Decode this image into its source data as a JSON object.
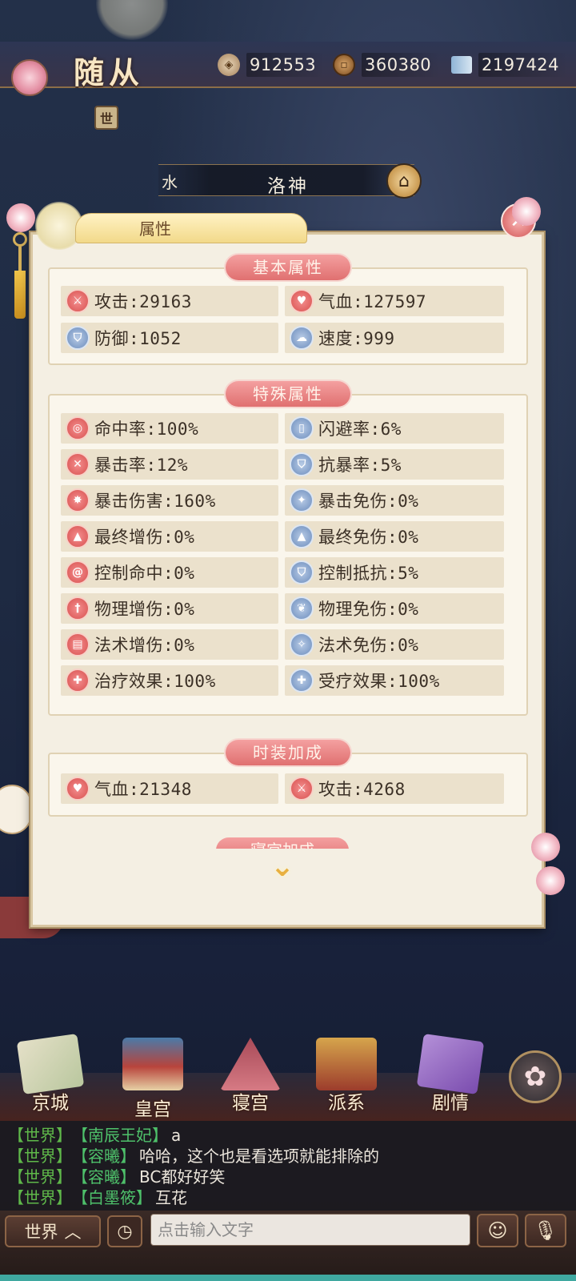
{
  "header": {
    "title": "随从",
    "currencies": [
      {
        "icon": "jade-token-icon",
        "value": "912553"
      },
      {
        "icon": "copper-coin-icon",
        "value": "360380"
      },
      {
        "icon": "book-icon",
        "value": "2197424"
      }
    ],
    "world_mini_label": "世"
  },
  "character": {
    "element": "水",
    "name": "洛神"
  },
  "panel": {
    "tab_label": "属性",
    "close_glyph": "✕",
    "sections": {
      "basic": {
        "title": "基本属性",
        "stats": [
          {
            "icon": "sword-icon",
            "text": "攻击:29163"
          },
          {
            "icon": "heart-icon",
            "text": "气血:127597"
          },
          {
            "icon": "shield-icon",
            "text": "防御:1052"
          },
          {
            "icon": "cloud-speed-icon",
            "text": "速度:999"
          }
        ]
      },
      "special": {
        "title": "特殊属性",
        "stats": [
          {
            "icon": "target-icon",
            "text": "命中率:100%"
          },
          {
            "icon": "scroll-icon",
            "text": "闪避率:6%"
          },
          {
            "icon": "crossed-swords-icon",
            "text": "暴击率:12%"
          },
          {
            "icon": "crit-resist-icon",
            "text": "抗暴率:5%"
          },
          {
            "icon": "burst-icon",
            "text": "暴击伤害:160%"
          },
          {
            "icon": "crit-reduction-icon",
            "text": "暴击免伤:0%"
          },
          {
            "icon": "final-damage-icon",
            "text": "最终增伤:0%"
          },
          {
            "icon": "final-reduction-icon",
            "text": "最终免伤:0%"
          },
          {
            "icon": "spiral-icon",
            "text": "控制命中:0%"
          },
          {
            "icon": "control-resist-icon",
            "text": "控制抵抗:5%"
          },
          {
            "icon": "dagger-icon",
            "text": "物理增伤:0%"
          },
          {
            "icon": "leaf-shield-icon",
            "text": "物理免伤:0%"
          },
          {
            "icon": "spellbook-icon",
            "text": "法术增伤:0%"
          },
          {
            "icon": "magic-shield-icon",
            "text": "法术免伤:0%"
          },
          {
            "icon": "heal-cross-icon",
            "text": "治疗效果:100%"
          },
          {
            "icon": "receive-heal-icon",
            "text": "受疗效果:100%"
          }
        ]
      },
      "fashion": {
        "title": "时装加成",
        "stats": [
          {
            "icon": "heart-icon",
            "text": "气血:21348"
          },
          {
            "icon": "sword-icon",
            "text": "攻击:4268"
          }
        ]
      },
      "next_title": "寝宫加成"
    }
  },
  "bottom_nav": [
    {
      "icon": "map-icon",
      "label": "京城"
    },
    {
      "icon": "palace-icon",
      "label": "皇宫"
    },
    {
      "icon": "bedchamber-icon",
      "label": "寝宫"
    },
    {
      "icon": "faction-banner-icon",
      "label": "派系"
    },
    {
      "icon": "story-book-icon",
      "label": "剧情"
    }
  ],
  "chat": {
    "lines": [
      {
        "channel": "【世界】",
        "name": "【南辰王妃】",
        "message": "a"
      },
      {
        "channel": "【世界】",
        "name": "【容曦】",
        "message": "哈哈，这个也是看选项就能排除的"
      },
      {
        "channel": "【世界】",
        "name": "【容曦】",
        "message": "BC都好好笑"
      },
      {
        "channel": "【世界】",
        "name": "【白墨筱】",
        "message": "互花"
      }
    ],
    "channel_label": "世界",
    "input_placeholder": "点击输入文字"
  },
  "colors": {
    "accent_red": "#e07070",
    "panel_bg": "#f4efe3",
    "chat_name_green": "#4ec06a"
  }
}
